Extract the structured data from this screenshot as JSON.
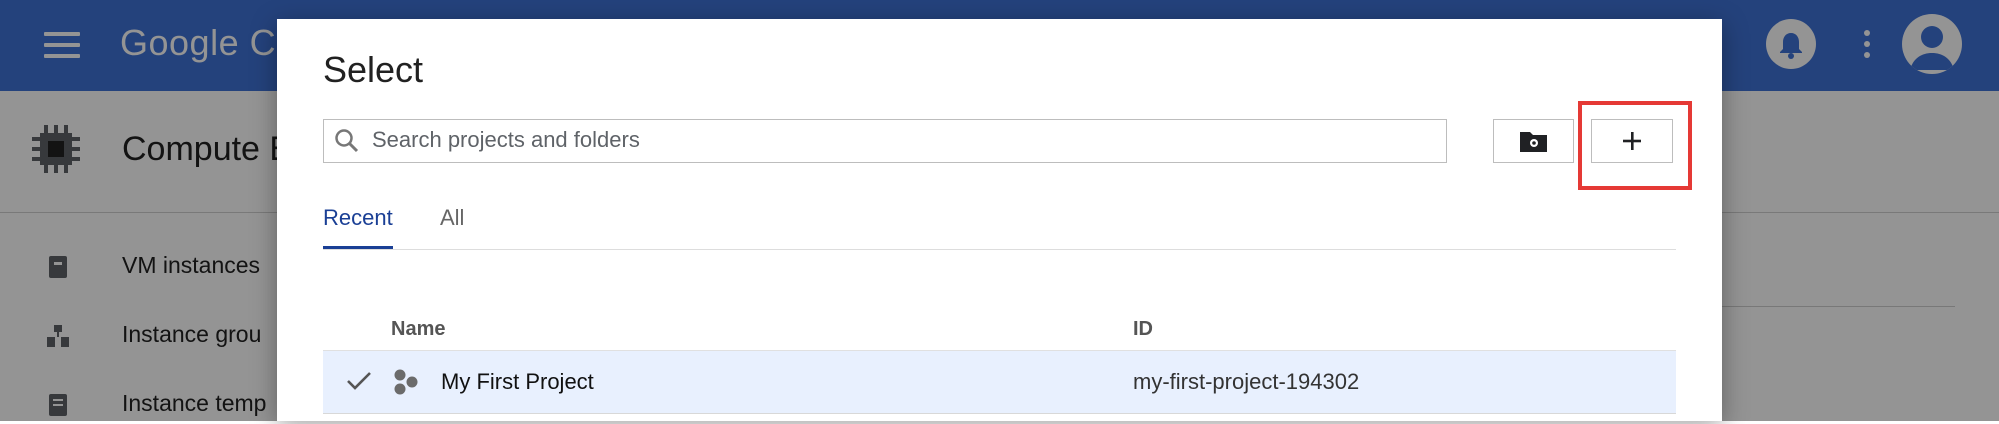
{
  "app": {
    "brand": "Google C"
  },
  "page": {
    "title": "Compute E"
  },
  "sidebar": {
    "items": [
      {
        "label": "VM instances",
        "icon": "vm-icon"
      },
      {
        "label": "Instance grou",
        "icon": "instance-group-icon"
      },
      {
        "label": "Instance temp",
        "icon": "instance-template-icon"
      }
    ]
  },
  "dialog": {
    "title": "Select",
    "search": {
      "placeholder": "Search projects and folders",
      "value": ""
    },
    "folder_button_icon": "new-folder-icon",
    "new_project_button_icon": "plus-icon",
    "tabs": [
      {
        "label": "Recent",
        "active": true
      },
      {
        "label": "All",
        "active": false
      }
    ],
    "columns": {
      "name": "Name",
      "id": "ID"
    },
    "rows": [
      {
        "name": "My First Project",
        "id": "my-first-project-194302",
        "selected": true
      }
    ]
  },
  "colors": {
    "topbar": "#3f72d6",
    "highlight": "#e53935",
    "selected_row": "#e8f0fe",
    "active_tab": "#1a3f95"
  }
}
